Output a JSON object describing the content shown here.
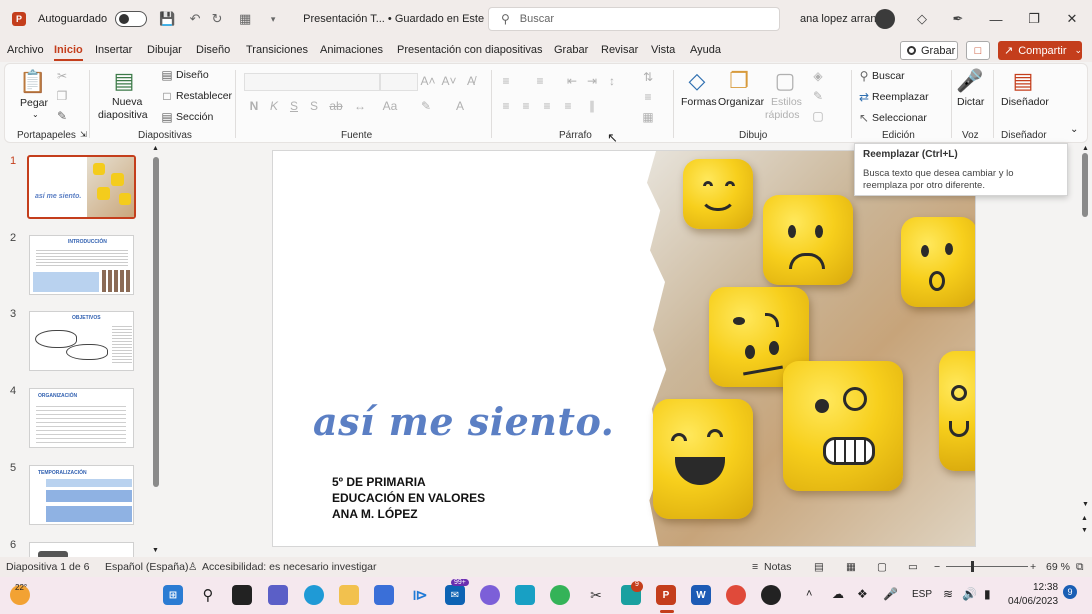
{
  "titlebar": {
    "app_letter": "P",
    "autosave_label": "Autoguardado",
    "doc_title": "Presentación T... • Guardado en Este PC",
    "search_placeholder": "Buscar",
    "user_name": "ana lopez arranz"
  },
  "menu": {
    "items": [
      "Archivo",
      "Inicio",
      "Insertar",
      "Dibujar",
      "Diseño",
      "Transiciones",
      "Animaciones",
      "Presentación con diapositivas",
      "Grabar",
      "Revisar",
      "Vista",
      "Ayuda"
    ],
    "active": "Inicio",
    "record_label": "Grabar",
    "share_label": "Compartir"
  },
  "ribbon": {
    "clipboard": {
      "paste_label": "Pegar",
      "group_label": "Portapapeles"
    },
    "slides": {
      "new_slide_label_1": "Nueva",
      "new_slide_label_2": "diapositiva",
      "layout_label": "Diseño",
      "reset_label": "Restablecer",
      "section_label": "Sección",
      "group_label": "Diapositivas"
    },
    "font": {
      "group_label": "Fuente"
    },
    "paragraph": {
      "group_label": "Párrafo"
    },
    "drawing": {
      "shapes_label": "Formas",
      "arrange_label": "Organizar",
      "quick_styles_label_1": "Estilos",
      "quick_styles_label_2": "rápidos",
      "group_label": "Dibujo"
    },
    "editing": {
      "find_label": "Buscar",
      "replace_label": "Reemplazar",
      "select_label": "Seleccionar",
      "group_label": "Edición"
    },
    "voice": {
      "dictate_label": "Dictar",
      "group_label": "Voz"
    },
    "designer": {
      "designer_label": "Diseñador",
      "group_label": "Diseñador"
    }
  },
  "tooltip": {
    "title": "Reemplazar (Ctrl+L)",
    "body": "Busca texto que desea cambiar y lo reemplaza por otro diferente."
  },
  "thumbnails": [
    {
      "num": "1",
      "title": "así me siento."
    },
    {
      "num": "2",
      "title": "INTRODUCCIÓN"
    },
    {
      "num": "3",
      "title": "OBJETIVOS"
    },
    {
      "num": "4",
      "title": "ORGANIZACIÓN"
    },
    {
      "num": "5",
      "title": "TEMPORALIZACIÓN"
    },
    {
      "num": "6",
      "title": ""
    }
  ],
  "slide": {
    "title": "así me siento.",
    "line1": "5º DE PRIMARIA",
    "line2": "EDUCACIÓN EN VALORES",
    "line3": "ANA M. LÓPEZ"
  },
  "status": {
    "slide_info": "Diapositiva 1 de 6",
    "language": "Español (España)",
    "accessibility": "Accesibilidad: es necesario investigar",
    "notes_label": "Notas",
    "zoom": "69 %"
  },
  "taskbar": {
    "weather_temp": "22°",
    "badge_1": "99+",
    "badge_2": "9",
    "lang": "ESP",
    "time": "12:38",
    "date": "04/06/2023",
    "notif_count": "9"
  },
  "colors": {
    "accent": "#c43e1c",
    "slide_title": "#5b7fc4"
  }
}
